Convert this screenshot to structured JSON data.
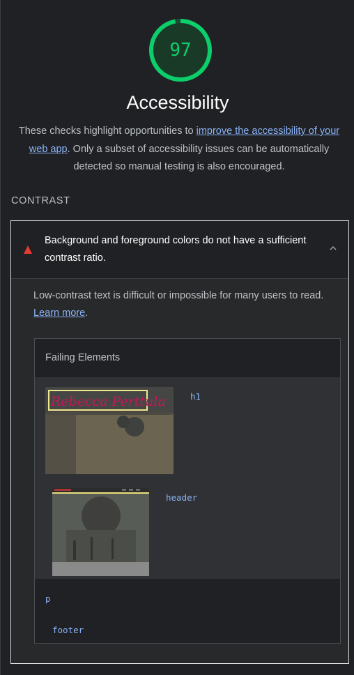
{
  "score": {
    "value": "97",
    "fraction": 0.97,
    "color": "#0cce6b"
  },
  "category": {
    "title": "Accessibility",
    "description_before": "These checks highlight opportunities to ",
    "description_link": "improve the accessibility of your web app",
    "description_after": ". Only a subset of accessibility issues can be automatically detected so manual testing is also encouraged."
  },
  "group": {
    "title": "CONTRAST"
  },
  "audit": {
    "status": "fail",
    "title": "Background and foreground colors do not have a sufficient contrast ratio.",
    "description": "Low-contrast text is difficult or impossible for many users to read. ",
    "learn_more": "Learn more",
    "after_link": ".",
    "table": {
      "header": "Failing Elements",
      "items": [
        {
          "thumbnail_text": "Rebecca Perttula",
          "node": "h1"
        },
        {
          "thumbnail_text": "",
          "node": "header"
        },
        {
          "thumbnail_text": "",
          "node": "p"
        },
        {
          "thumbnail_text": "",
          "node": "footer"
        }
      ]
    }
  },
  "colors": {
    "pass_green": "#0cce6b",
    "fail_red": "#e53935",
    "link_blue": "#8ab4f8",
    "background": "#202124"
  }
}
